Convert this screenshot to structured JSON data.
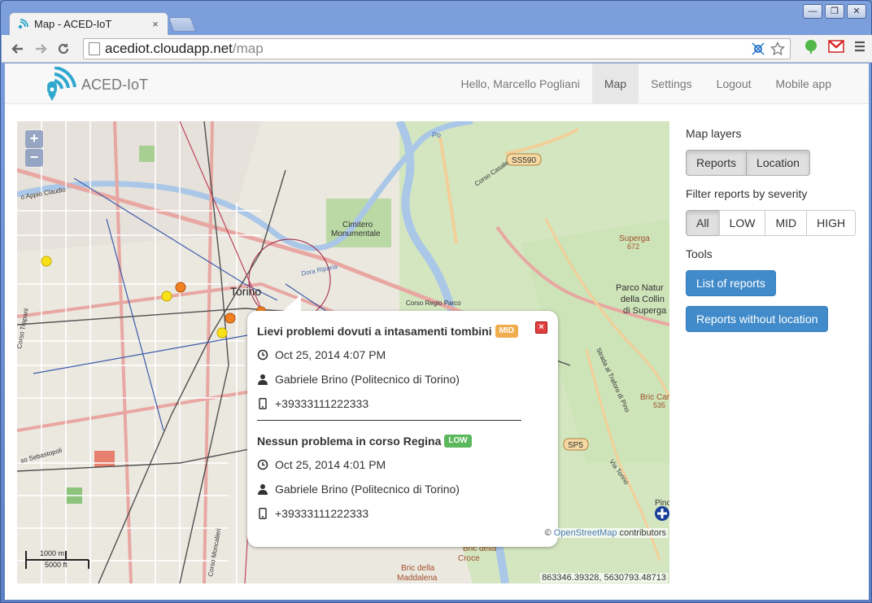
{
  "browser": {
    "tab_title": "Map - ACED-IoT",
    "tab_close": "×",
    "url_host": "acediot.cloudapp.net",
    "url_path": "/map",
    "window_buttons": [
      "—",
      "❐",
      "✕"
    ]
  },
  "navbar": {
    "brand": "ACED-IoT",
    "links": [
      {
        "label": "Hello, Marcello Pogliani",
        "active": false
      },
      {
        "label": "Map",
        "active": true
      },
      {
        "label": "Settings",
        "active": false
      },
      {
        "label": "Logout",
        "active": false
      },
      {
        "label": "Mobile app",
        "active": false
      }
    ]
  },
  "map": {
    "zoom_in": "+",
    "zoom_out": "−",
    "attribution_prefix": "©",
    "attribution_link": "OpenStreetMap",
    "attribution_suffix": "contributors",
    "coordinates": "863346.39328, 5630793.48713",
    "scale_metric": "1000 m",
    "scale_imperial": "5000 ft",
    "labels": {
      "torino": "Torino",
      "cimitero1": "Cimitero",
      "cimitero2": "Monumentale",
      "parco1": "Parco Natur",
      "parco2": "della Collin",
      "parco3": "di Superga",
      "superga": "Superga",
      "superga_num": "672",
      "ss590": "SS590",
      "sp5": "SP5",
      "bric_croce1": "Bric della",
      "bric_croce2": "Croce",
      "bric_madd1": "Bric della",
      "bric_madd2": "Maddalena",
      "bric_car": "Bric Car",
      "bric_num": "535",
      "pino": "Pino",
      "corso_casale": "Corso Casale",
      "via_torino": "Via Torino",
      "strada_traforo": "Strada al Traforo di Pino",
      "corso_regio": "Corso Regio Parco",
      "appio": "o Appio Claudio",
      "corso_trapani": "Corso Trapani",
      "corso_moncalieri": "Corso Moncalieri",
      "corso_sebastopoli": "so Sebastopoli",
      "dora": "Dora Riparia",
      "po": "Po"
    }
  },
  "popup": {
    "close": "×",
    "reports": [
      {
        "title": "Lievi problemi dovuti a intasamenti tombini",
        "severity": "MID",
        "datetime": "Oct 25, 2014 4:07 PM",
        "author": "Gabriele Brino (Politecnico di Torino)",
        "phone": "+39333111222333"
      },
      {
        "title": "Nessun problema in corso Regina",
        "severity": "LOW",
        "datetime": "Oct 25, 2014 4:01 PM",
        "author": "Gabriele Brino (Politecnico di Torino)",
        "phone": "+39333111222333"
      }
    ]
  },
  "sidebar": {
    "map_layers_label": "Map layers",
    "layers": [
      {
        "label": "Reports",
        "active": true
      },
      {
        "label": "Location",
        "active": true
      }
    ],
    "filter_label": "Filter reports by severity",
    "filters": [
      {
        "label": "All",
        "active": true
      },
      {
        "label": "LOW",
        "active": false
      },
      {
        "label": "MID",
        "active": false
      },
      {
        "label": "HIGH",
        "active": false
      }
    ],
    "tools_label": "Tools",
    "list_button": "List of reports",
    "without_location_button": "Reports without location"
  },
  "colors": {
    "primary": "#428bca",
    "mid": "#f0ad4e",
    "low": "#5cb85c",
    "marker_yellow": "#f7e11a",
    "marker_orange": "#f08020"
  }
}
